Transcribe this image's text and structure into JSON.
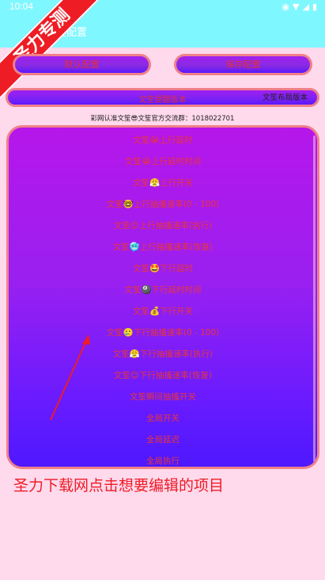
{
  "status_bar": {
    "time": "10:04",
    "icons": [
      "eye-icon",
      "wifi-icon",
      "signal-icon",
      "battery-icon"
    ]
  },
  "app_bar": {
    "title": "一键配置",
    "background": "#7ff7ff"
  },
  "watermark": {
    "text": "圣力专测",
    "color": "#ee1c24"
  },
  "buttons": {
    "default": "默认配置",
    "save": "保存配置"
  },
  "version": {
    "label": "文笙提醒版本",
    "tag": "文笙布局版本"
  },
  "notice": "彩网认准文笙😎文笙官方交流群：1018022701",
  "list": {
    "items": [
      "文笙😭上行延时",
      "文笙😭上行延时时间",
      "文笙😤上行开关",
      "文笙🤓上行抽搐速率(0 - 100)",
      "文笙😊上行抽搐速率(执行)",
      "文笙🥶上行抽搐速率(恢复)",
      "文笙🤩下行延时",
      "文笙🎱下行延时时间",
      "文笙💰下行开关",
      "文笙🥲下行抽搐速率(0 - 100)",
      "文笙😤下行抽搐速率(执行)",
      "文笙😊下行抽搐速率(恢复)",
      "文笙瞬间抽搐开关",
      "全局开关",
      "全局延迟",
      "全局执行"
    ]
  },
  "caption": "圣力下载网点击想要编辑的项目",
  "colors": {
    "page_bg": "#ffd9ec",
    "accent_border": "#f0808a",
    "gradient_top": "#b616ea",
    "gradient_bottom": "#4e18ff",
    "item_text": "#e8353d"
  }
}
